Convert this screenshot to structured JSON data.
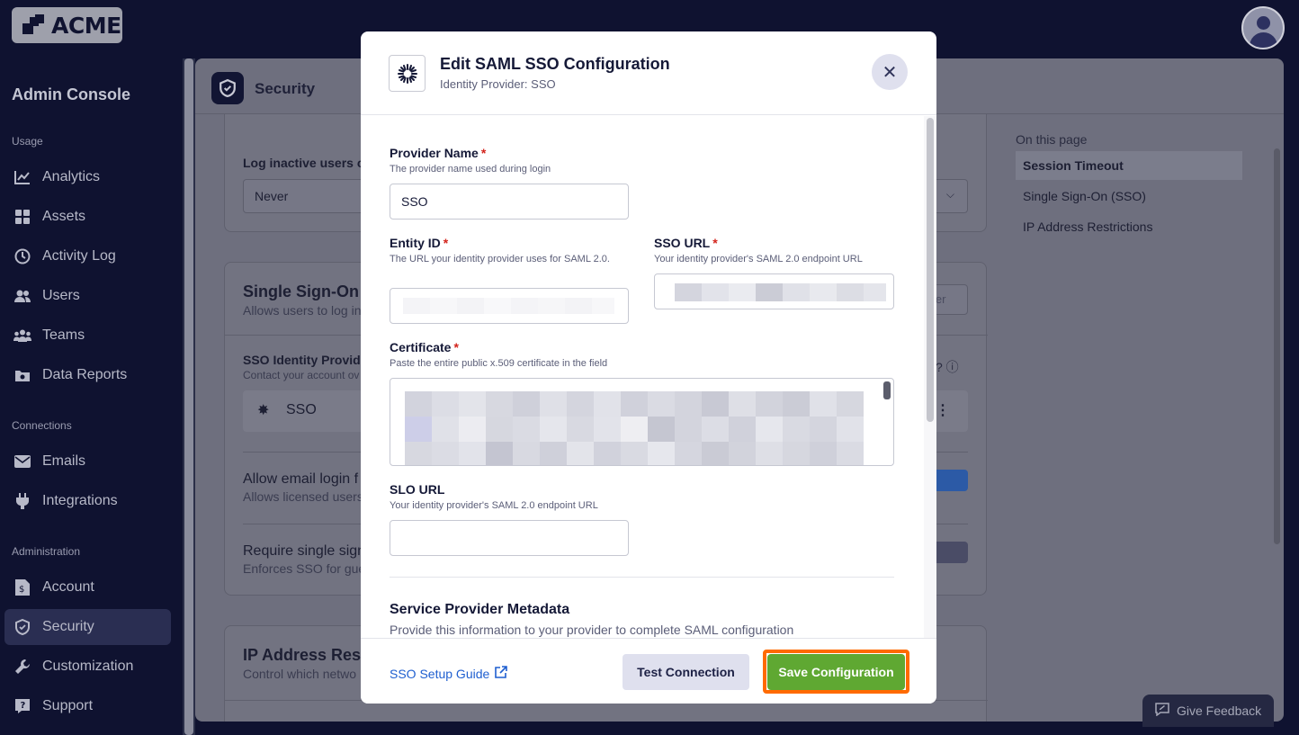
{
  "brand": {
    "logo_text": "ACME"
  },
  "sidebar": {
    "title": "Admin Console",
    "sections": [
      {
        "label": "Usage"
      },
      {
        "label": "Connections"
      },
      {
        "label": "Administration"
      }
    ],
    "items": [
      {
        "label": "Analytics",
        "icon": "chart-line-icon"
      },
      {
        "label": "Assets",
        "icon": "grid-icon"
      },
      {
        "label": "Activity Log",
        "icon": "history-icon"
      },
      {
        "label": "Users",
        "icon": "user-icon"
      },
      {
        "label": "Teams",
        "icon": "team-icon"
      },
      {
        "label": "Data Reports",
        "icon": "report-icon"
      },
      {
        "label": "Emails",
        "icon": "envelope-icon"
      },
      {
        "label": "Integrations",
        "icon": "plug-icon"
      },
      {
        "label": "Account",
        "icon": "account-icon"
      },
      {
        "label": "Security",
        "icon": "shield-icon",
        "active": true
      },
      {
        "label": "Customization",
        "icon": "wrench-icon"
      },
      {
        "label": "Support",
        "icon": "support-icon"
      }
    ]
  },
  "page": {
    "title": "Security",
    "log_inactive_label": "Log inactive users ou",
    "log_inactive_value": "Never",
    "sso_card": {
      "title": "Single Sign-On (",
      "subtitle": "Allows users to log in",
      "idp_title": "SSO Identity Provide",
      "idp_sub": "Contact your account ov",
      "idp_name": "SSO",
      "btn_partial": "ler",
      "allow_email_title": "Allow email login f",
      "allow_email_sub": "Allows licensed users",
      "require_sso_title": "Require single sign",
      "require_sso_sub": "Enforces SSO for gue"
    },
    "ip_card": {
      "title": "IP Address Restr",
      "subtitle": "Control which netwo"
    },
    "toc": {
      "title": "On this page",
      "items": [
        "Session Timeout",
        "Single Sign-On (SSO)",
        "IP Address Restrictions"
      ]
    }
  },
  "modal": {
    "title": "Edit SAML SSO Configuration",
    "subtitle": "Identity Provider: SSO",
    "fields": {
      "provider_name": {
        "label": "Provider Name",
        "help": "The provider name used during login",
        "value": "SSO"
      },
      "entity_id": {
        "label": "Entity ID",
        "help": "The URL your identity provider uses for SAML 2.0."
      },
      "sso_url": {
        "label": "SSO URL",
        "help": "Your identity provider's SAML 2.0 endpoint URL"
      },
      "certificate": {
        "label": "Certificate",
        "help": "Paste the entire public x.509 certificate in the field"
      },
      "slo_url": {
        "label": "SLO URL",
        "help": "Your identity provider's SAML 2.0 endpoint URL",
        "value": ""
      }
    },
    "required_mark": "*",
    "metadata_title": "Service Provider Metadata",
    "metadata_sub": "Provide this information to your provider to complete SAML configuration",
    "footer": {
      "guide_link": "SSO Setup Guide",
      "test_button": "Test Connection",
      "save_button": "Save Configuration"
    }
  },
  "feedback_button": "Give Feedback",
  "colors": {
    "accent_green": "#5fa832",
    "highlight_orange": "#ff6a00",
    "required_red": "#d3241c",
    "link_blue": "#1f5fd0"
  }
}
